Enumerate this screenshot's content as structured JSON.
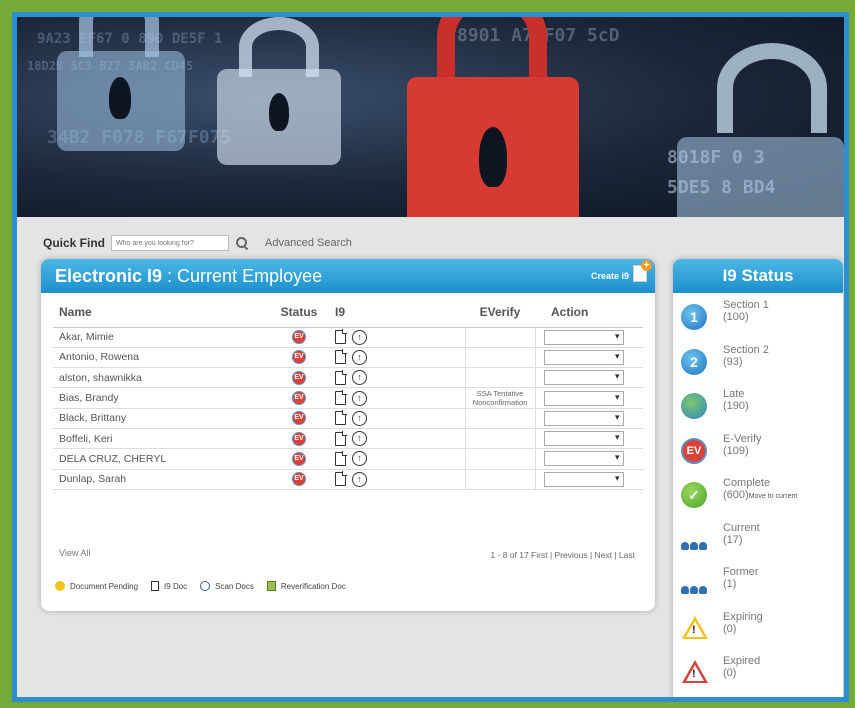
{
  "search": {
    "label": "Quick Find",
    "placeholder": "Who are you looking for?",
    "advanced": "Advanced Search"
  },
  "panel": {
    "title": "Electronic I9",
    "subtitle": ": Current Employee",
    "create_label": "Create i9"
  },
  "columns": {
    "name": "Name",
    "status": "Status",
    "i9": "I9",
    "everify": "EVerify",
    "action": "Action"
  },
  "employees": [
    {
      "name": "Akar, Mimie",
      "everify": ""
    },
    {
      "name": "Antonio, Rowena",
      "everify": ""
    },
    {
      "name": "alston, shawnikka",
      "everify": ""
    },
    {
      "name": "Bias, Brandy",
      "everify": "SSA Tentative Nonconfirmation"
    },
    {
      "name": "Black, Brittany",
      "everify": ""
    },
    {
      "name": "Boffeli, Keri",
      "everify": ""
    },
    {
      "name": "DELA CRUZ, CHERYL",
      "everify": ""
    },
    {
      "name": "Dunlap, Sarah",
      "everify": ""
    }
  ],
  "ev_badge": "EV",
  "scan_glyph": "↑",
  "footer": {
    "view_all": "View All",
    "pager": "1 - 8 of 17  First | Previous | Next | Last"
  },
  "legend": {
    "pending": "Document Pending",
    "i9_doc": "I9 Doc",
    "scan": "Scan Docs",
    "reverification": "Reverification Doc"
  },
  "status_panel": {
    "title": "I9 Status",
    "items": [
      {
        "label": "Section 1",
        "count": "(100)",
        "icon": "1",
        "note": ""
      },
      {
        "label": "Section 2",
        "count": "(93)",
        "icon": "2",
        "note": ""
      },
      {
        "label": "Late",
        "count": "(190)",
        "icon": "",
        "note": ""
      },
      {
        "label": "E-Verify",
        "count": "(109)",
        "icon": "EV",
        "note": ""
      },
      {
        "label": "Complete",
        "count": "(600)",
        "icon": "✓",
        "note": "Move to current"
      },
      {
        "label": "Current",
        "count": "(17)",
        "icon": "",
        "note": ""
      },
      {
        "label": "Former",
        "count": "(1)",
        "icon": "",
        "note": ""
      },
      {
        "label": "Expiring",
        "count": "(0)",
        "icon": "!",
        "note": ""
      },
      {
        "label": "Expired",
        "count": "(0)",
        "icon": "!",
        "note": ""
      }
    ]
  },
  "colors": {
    "frame_green": "#76a83a",
    "frame_blue": "#2b8fd0",
    "header_blue": "#1d8fcc",
    "lock_red": "#d63a33"
  }
}
